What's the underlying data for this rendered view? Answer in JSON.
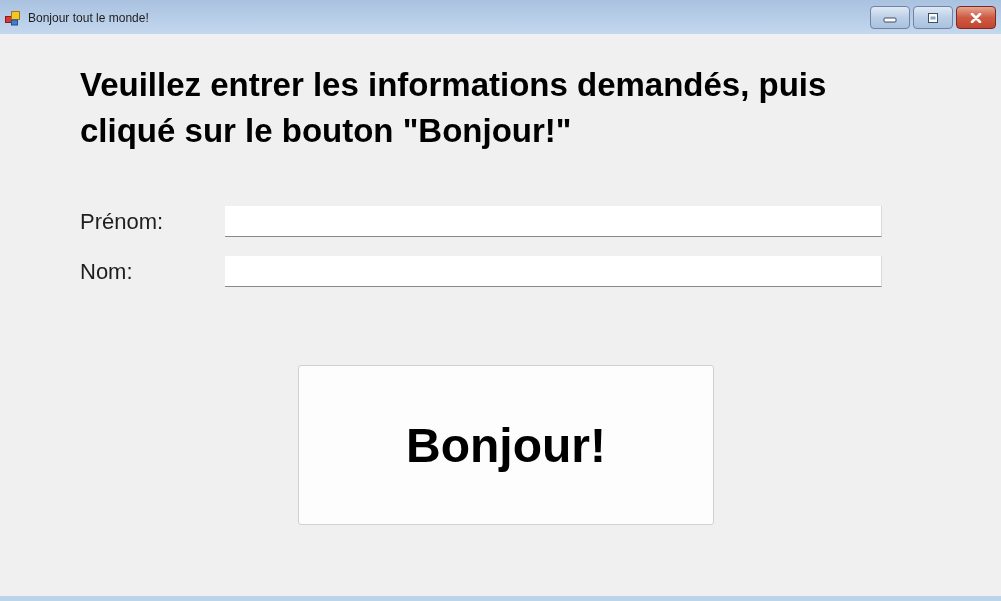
{
  "window": {
    "title": "Bonjour tout le monde!"
  },
  "heading": "Veuillez entrer les informations demandés, puis cliqué sur le bouton \"Bonjour!\"",
  "fields": [
    {
      "label": "Prénom:"
    },
    {
      "label": "Nom:"
    }
  ],
  "button": {
    "label": "Bonjour!"
  }
}
